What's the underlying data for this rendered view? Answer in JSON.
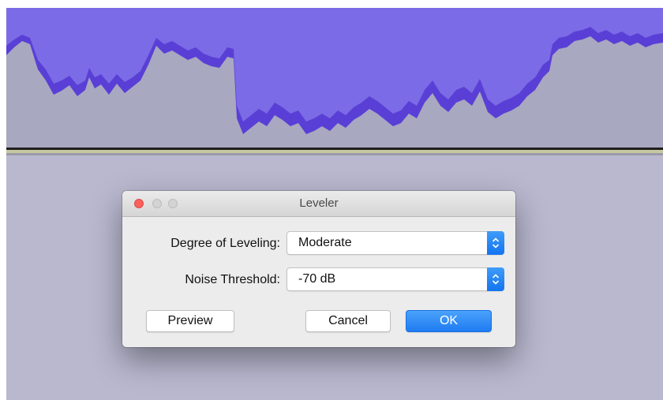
{
  "dialog": {
    "title": "Leveler",
    "fields": [
      {
        "label": "Degree of Leveling:",
        "value": "Moderate"
      },
      {
        "label": "Noise Threshold:",
        "value": "-70 dB"
      }
    ],
    "buttons": {
      "preview": "Preview",
      "cancel": "Cancel",
      "ok": "OK"
    }
  },
  "colors": {
    "waveform": "#7b6be6",
    "waveform_peak": "#5a3fd6",
    "waveform_bg": "#a8a8c0",
    "track_bg": "#b9b8cf",
    "accent": "#1f7cf2"
  },
  "icons": {
    "close": "close-icon",
    "minimize": "minimize-icon",
    "zoom": "zoom-icon",
    "stepper": "up-down-chevron-icon"
  }
}
